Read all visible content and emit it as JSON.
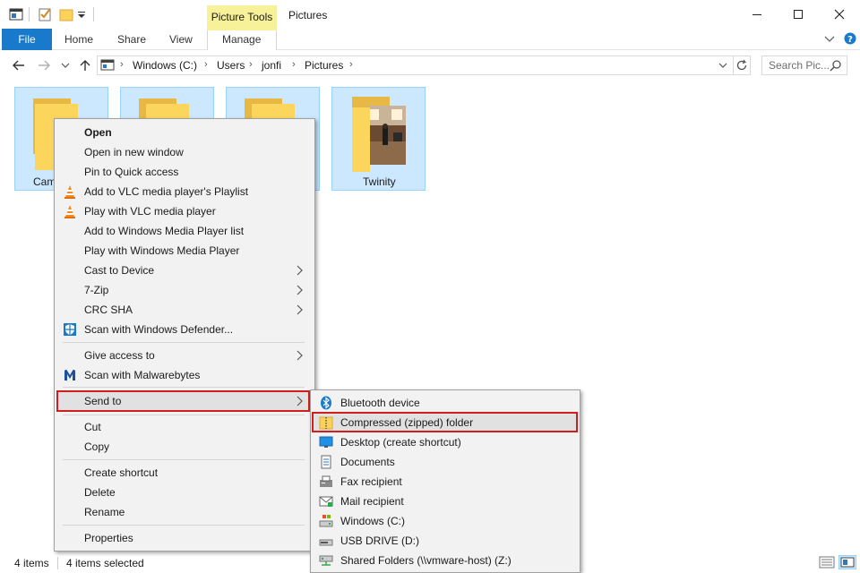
{
  "window": {
    "title": "Pictures",
    "contextual_tab_group": "Picture Tools"
  },
  "ribbon": {
    "tabs": [
      "File",
      "Home",
      "Share",
      "View",
      "Manage"
    ]
  },
  "address": {
    "path": [
      "Windows (C:)",
      "Users",
      "jonfi",
      "Pictures"
    ],
    "search_placeholder": "Search Pic..."
  },
  "folders": [
    {
      "label": "Cam"
    },
    {
      "label": ""
    },
    {
      "label": ""
    },
    {
      "label": "Twinity"
    }
  ],
  "context_menu": {
    "items": [
      {
        "label": "Open",
        "bold": true
      },
      {
        "label": "Open in new window"
      },
      {
        "label": "Pin to Quick access"
      },
      {
        "label": "Add to VLC media player's Playlist",
        "icon": "vlc-icon"
      },
      {
        "label": "Play with VLC media player",
        "icon": "vlc-icon"
      },
      {
        "label": "Add to Windows Media Player list"
      },
      {
        "label": "Play with Windows Media Player"
      },
      {
        "label": "Cast to Device",
        "submenu": true
      },
      {
        "label": "7-Zip",
        "submenu": true
      },
      {
        "label": "CRC SHA",
        "submenu": true
      },
      {
        "label": "Scan with Windows Defender...",
        "icon": "defender-icon"
      },
      {
        "label": "Give access to",
        "submenu": true
      },
      {
        "label": "Scan with Malwarebytes",
        "icon": "malwarebytes-icon"
      },
      {
        "label": "Send to",
        "submenu": true,
        "highlighted": true
      },
      {
        "label": "Cut"
      },
      {
        "label": "Copy"
      },
      {
        "label": "Create shortcut"
      },
      {
        "label": "Delete"
      },
      {
        "label": "Rename"
      },
      {
        "label": "Properties"
      }
    ]
  },
  "send_to_menu": {
    "items": [
      {
        "label": "Bluetooth device",
        "icon": "bluetooth-icon"
      },
      {
        "label": "Compressed (zipped) folder",
        "icon": "zip-folder-icon",
        "highlighted": true
      },
      {
        "label": "Desktop (create shortcut)",
        "icon": "desktop-icon"
      },
      {
        "label": "Documents",
        "icon": "documents-icon"
      },
      {
        "label": "Fax recipient",
        "icon": "fax-icon"
      },
      {
        "label": "Mail recipient",
        "icon": "mail-icon"
      },
      {
        "label": "Windows (C:)",
        "icon": "drive-icon"
      },
      {
        "label": "USB DRIVE (D:)",
        "icon": "usb-drive-icon"
      },
      {
        "label": "Shared Folders (\\\\vmware-host) (Z:)",
        "icon": "network-drive-icon"
      }
    ]
  },
  "status": {
    "item_count": "4 items",
    "selected_count": "4 items selected"
  },
  "colors": {
    "accent": "#1979ca",
    "selection": "#cce8ff",
    "highlight_border": "#d01e1e",
    "contextual_tab": "#f7f19a"
  }
}
